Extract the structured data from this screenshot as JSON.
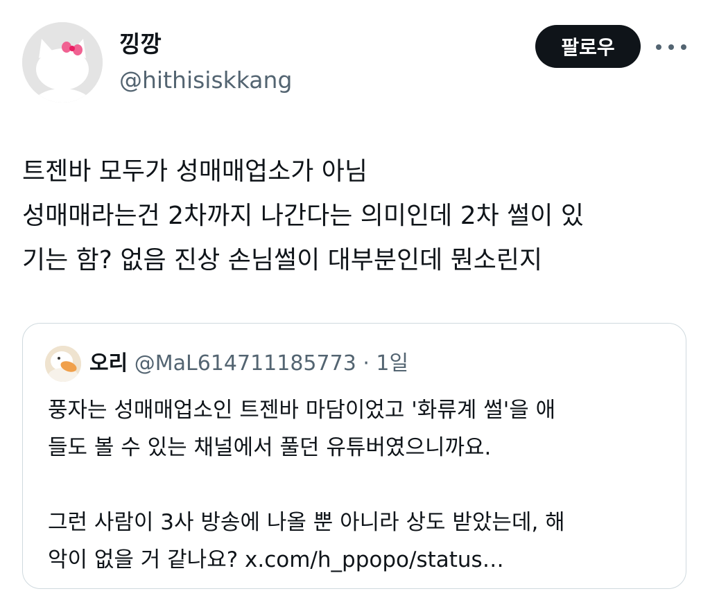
{
  "author": {
    "display_name": "낑깡",
    "handle": "@hithisiskkang",
    "avatar_icon": "hello-kitty-avatar-icon"
  },
  "actions": {
    "follow_label": "팔로우",
    "more_icon": "more-horizontal-icon"
  },
  "tweet": {
    "lines": [
      "트젠바 모두가 성매매업소가 아님",
      "성매매라는건 2차까지 나간다는 의미인데 2차 썰이 있",
      "기는 함? 없음 진상 손님썰이 대부분인데 뭔소린지"
    ]
  },
  "quote": {
    "avatar_icon": "duck-avatar-icon",
    "display_name": "오리",
    "handle": "@MaL614711185773",
    "separator": " · ",
    "time": "1일",
    "lines": [
      "풍자는 성매매업소인 트젠바 마담이었고 '화류계 썰'을 애",
      "들도 볼 수 있는 채널에서 풀던 유튜버였으니까요.",
      "",
      "그런 사람이 3사 방송에 나올 뿐 아니라 상도 받았는데, 해",
      "악이 없을 거 같나요? x.com/h_ppopo/status…"
    ]
  },
  "colors": {
    "text_primary": "#0f1419",
    "text_secondary": "#536471",
    "border": "#cfd9de",
    "follow_bg": "#0f1419",
    "bow": "#f06292"
  }
}
